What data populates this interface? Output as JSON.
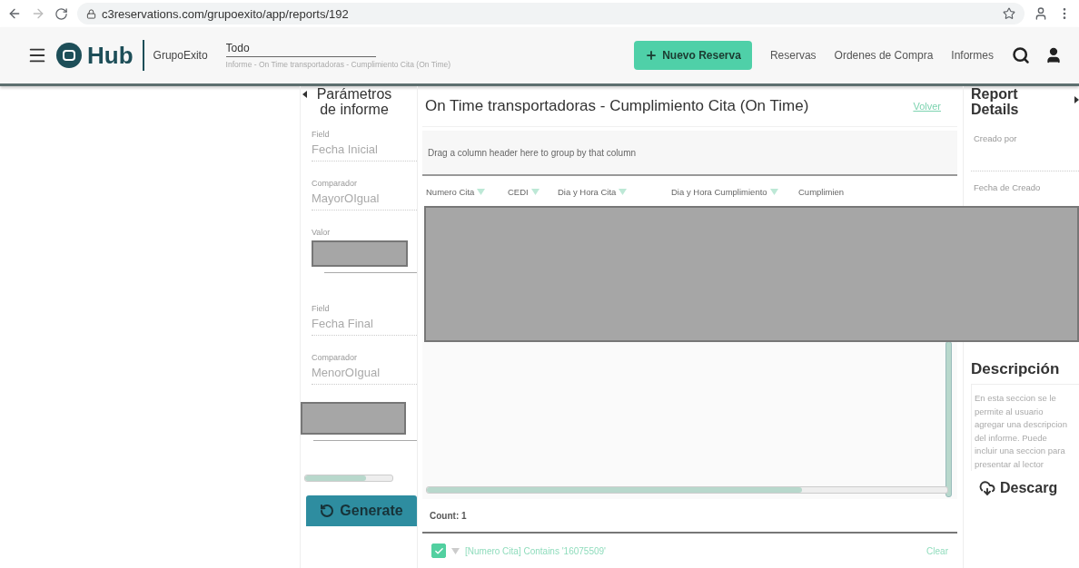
{
  "browser": {
    "url": "c3reservations.com/grupoexito/app/reports/192"
  },
  "header": {
    "logo": "Hub",
    "org": "GrupoExito",
    "search_value": "Todo",
    "breadcrumb": "Informe - On Time transportadoras - Cumplimiento Cita (On Time)",
    "new_button": "Nuevo Reserva",
    "nav": [
      "Reservas",
      "Ordenes de Compra",
      "Informes"
    ]
  },
  "params_panel": {
    "title": "Parámetros de informe",
    "fields": [
      {
        "kind": "text",
        "label": "Field",
        "value": "Fecha Inicial"
      },
      {
        "kind": "text",
        "label": "Comparador",
        "value": "MayorOIgual"
      },
      {
        "kind": "redacted",
        "label": "Valor"
      },
      {
        "kind": "text",
        "label": "Field",
        "value": "Fecha Final"
      },
      {
        "kind": "text",
        "label": "Comparador",
        "value": "MenorOIgual"
      },
      {
        "kind": "redacted"
      }
    ],
    "generate_button": "Generate"
  },
  "report": {
    "title": "On Time transportadoras - Cumplimiento Cita (On Time)",
    "back_link": "Volver",
    "group_hint": "Drag a column header here to group by that column",
    "columns": [
      {
        "label": "Numero Cita",
        "filter": true
      },
      {
        "label": "CEDI",
        "filter": true
      },
      {
        "label": "Dia y Hora Cita",
        "filter": true
      },
      {
        "label": "Dia y Hora Cumplimiento",
        "filter": true
      },
      {
        "label": "Cumplimien",
        "filter": false
      }
    ],
    "count": "Count: 1",
    "filter": {
      "checked": true,
      "text": "[Numero Cita] Contains '16075509'",
      "clear": "Clear"
    }
  },
  "details": {
    "title": "Report Details",
    "fields": [
      "Creado por",
      "Fecha de Creado"
    ],
    "description_title": "Descripción",
    "description": "En esta seccion se le permite al usuario agregar una descripcion del informe. Puede incluir una seccion para presentar al lector",
    "download": "Descarg"
  }
}
